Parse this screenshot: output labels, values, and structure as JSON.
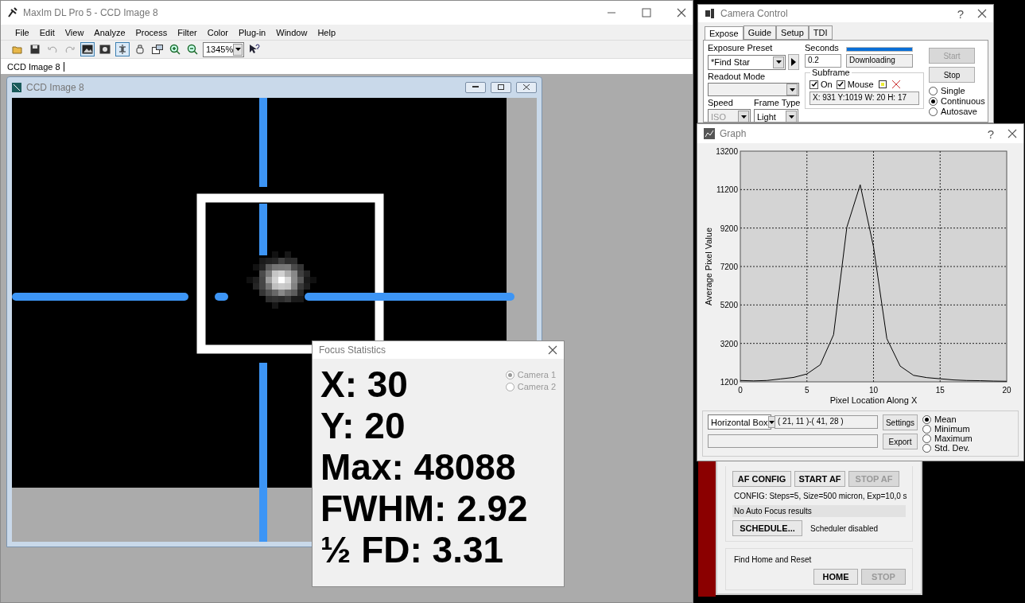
{
  "main_window": {
    "title": "MaxIm DL Pro 5 - CCD Image 8",
    "menu": [
      "File",
      "Edit",
      "View",
      "Analyze",
      "Process",
      "Filter",
      "Color",
      "Plug-in",
      "Window",
      "Help"
    ],
    "zoom": "1345%",
    "doc_tab": "CCD Image 8"
  },
  "image_window": {
    "title": "CCD Image 8"
  },
  "focus_statistics": {
    "title": "Focus Statistics",
    "lines": [
      "X: 30",
      "Y: 20",
      "Max: 48088",
      "FWHM: 2.92",
      "½ FD: 3.31"
    ],
    "cameras": [
      {
        "label": "Camera 1",
        "selected": true
      },
      {
        "label": "Camera 2",
        "selected": false
      }
    ]
  },
  "camera_control": {
    "title": "Camera Control",
    "help": "?",
    "tabs": [
      {
        "label": "Expose",
        "selected": true
      },
      {
        "label": "Guide",
        "selected": false
      },
      {
        "label": "Setup",
        "selected": false
      },
      {
        "label": "TDI",
        "selected": false
      }
    ],
    "exposure_preset_label": "Exposure Preset",
    "exposure_preset": "*Find Star",
    "seconds_label": "Seconds",
    "seconds": "0.2",
    "progress": {
      "level": 1
    },
    "status": "Downloading",
    "readout_mode_label": "Readout Mode",
    "speed_label": "Speed",
    "speed": "ISO",
    "frame_type_label": "Frame Type",
    "frame_type": "Light",
    "subframe": {
      "label": "Subframe",
      "on": {
        "label": "On",
        "checked": true
      },
      "mouse": {
        "label": "Mouse",
        "checked": true
      },
      "coords": "X: 931 Y:1019 W:  20 H:  17"
    },
    "start": {
      "label": "Start",
      "disabled": true
    },
    "stop": {
      "label": "Stop",
      "disabled": false
    },
    "modes": [
      {
        "label": "Single",
        "selected": false
      },
      {
        "label": "Continuous",
        "selected": true
      },
      {
        "label": "Autosave",
        "selected": false
      }
    ]
  },
  "graph": {
    "title": "Graph",
    "help": "?",
    "chart_data": {
      "type": "line",
      "xlabel": "Pixel Location Along X",
      "ylabel": "Average Pixel Value",
      "x": [
        0,
        1,
        2,
        3,
        4,
        5,
        6,
        7,
        8,
        9,
        10,
        11,
        12,
        13,
        14,
        15,
        16,
        17,
        18,
        19,
        20
      ],
      "series": [
        {
          "color": "#000000",
          "values": [
            1270,
            1250,
            1270,
            1350,
            1430,
            1610,
            2090,
            3650,
            9250,
            11450,
            8220,
            3450,
            2020,
            1540,
            1420,
            1360,
            1300,
            1270,
            1260,
            1240,
            1230
          ]
        }
      ],
      "xlim": [
        0,
        20
      ],
      "ylim": [
        1200,
        13200
      ],
      "xticks": [
        0,
        5,
        10,
        15,
        20
      ],
      "yticks": [
        1200,
        3200,
        5200,
        7200,
        9200,
        11200,
        13200
      ],
      "grid": true
    },
    "mode": "Horizontal Box",
    "range": "( 21, 11 )-( 41, 28 )",
    "buttons": [
      "Settings",
      "Export"
    ],
    "stats": [
      {
        "label": "Mean",
        "selected": true
      },
      {
        "label": "Minimum",
        "selected": false
      },
      {
        "label": "Maximum",
        "selected": false
      },
      {
        "label": "Std. Dev.",
        "selected": false
      }
    ]
  },
  "focuser": {
    "af_buttons": [
      {
        "label": "AF CONFIG",
        "disabled": false
      },
      {
        "label": "START AF",
        "disabled": false
      },
      {
        "label": "STOP AF",
        "disabled": true
      }
    ],
    "config": "CONFIG: Steps=5, Size=500 micron, Exp=10,0 s",
    "results": "No Auto Focus results",
    "schedule": "SCHEDULE...",
    "scheduler_status": "Scheduler disabled",
    "home_group": "Find Home and Reset",
    "home_buttons": [
      {
        "label": "HOME",
        "disabled": false
      },
      {
        "label": "STOP",
        "disabled": true
      }
    ]
  }
}
